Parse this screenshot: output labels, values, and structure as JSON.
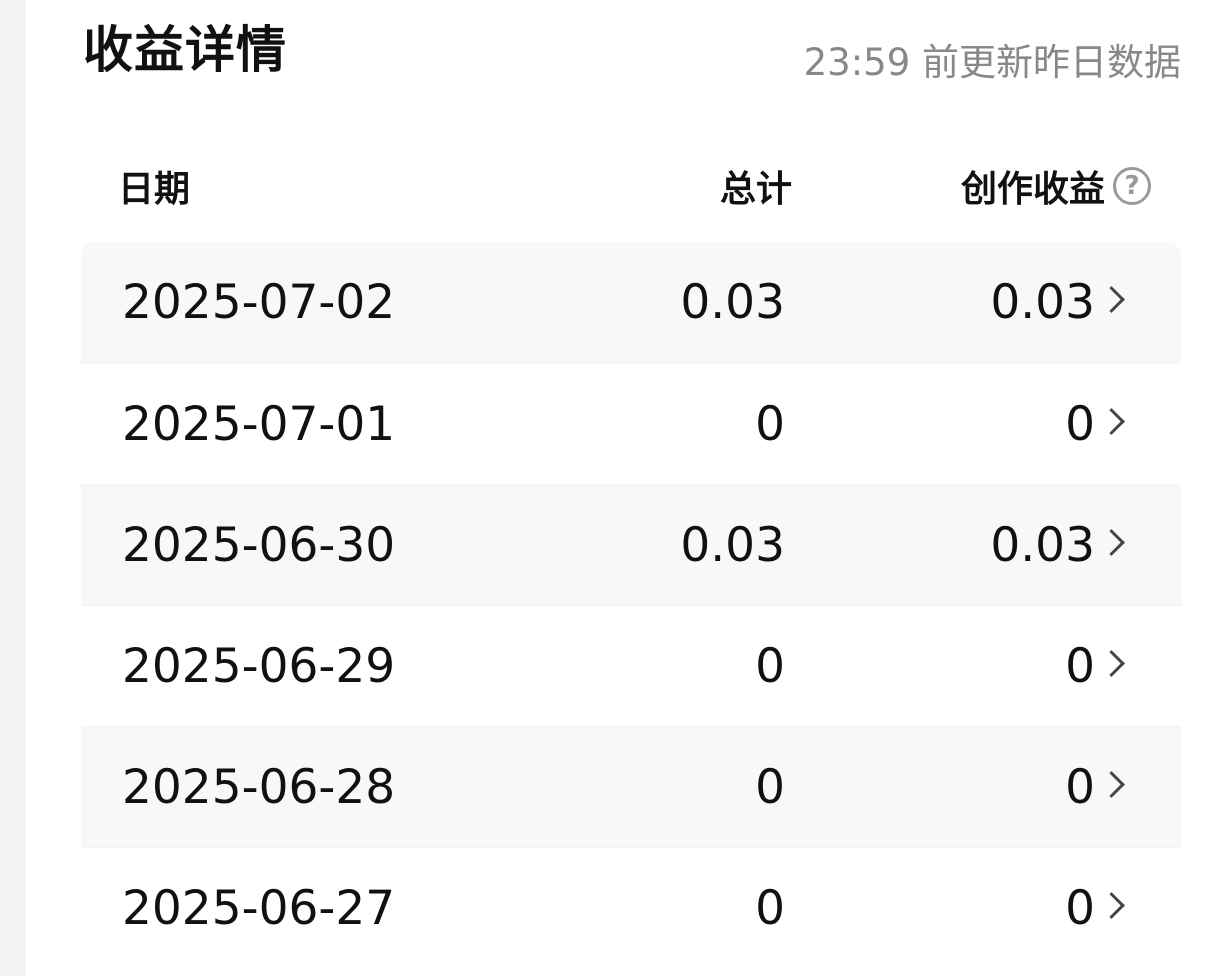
{
  "header": {
    "title": "收益详情",
    "update_note": "23:59 前更新昨日数据"
  },
  "table": {
    "columns": {
      "date": "日期",
      "total": "总计",
      "creative": "创作收益"
    },
    "help_icon": "question-circle-icon",
    "rows": [
      {
        "date": "2025-07-02",
        "total": "0.03",
        "creative": "0.03"
      },
      {
        "date": "2025-07-01",
        "total": "0",
        "creative": "0"
      },
      {
        "date": "2025-06-30",
        "total": "0.03",
        "creative": "0.03"
      },
      {
        "date": "2025-06-29",
        "total": "0",
        "creative": "0"
      },
      {
        "date": "2025-06-28",
        "total": "0",
        "creative": "0"
      },
      {
        "date": "2025-06-27",
        "total": "0",
        "creative": "0"
      }
    ]
  },
  "colors": {
    "row_shade": "#f7f8fa",
    "muted_text": "#888888",
    "text": "#111111"
  }
}
